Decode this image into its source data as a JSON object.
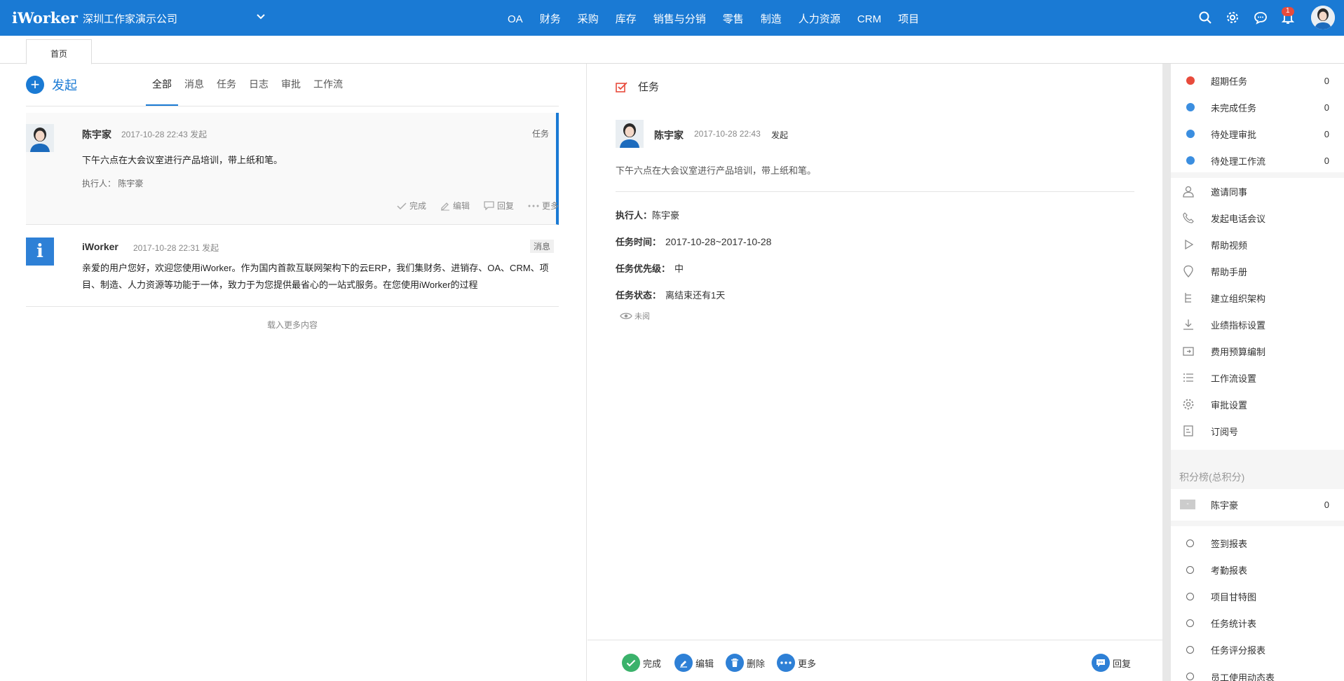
{
  "topbar": {
    "logo": "iWorker",
    "company": "深圳工作家演示公司",
    "nav": [
      "OA",
      "财务",
      "采购",
      "库存",
      "销售与分销",
      "零售",
      "制造",
      "人力资源",
      "CRM",
      "项目"
    ],
    "notification_count": "1",
    "icons": [
      "search-icon",
      "gear-icon",
      "chat-icon",
      "bell-icon",
      "avatar"
    ]
  },
  "tabs": {
    "home": "首页"
  },
  "left": {
    "launch_label": "发起",
    "filters": [
      "全部",
      "消息",
      "任务",
      "日志",
      "审批",
      "工作流"
    ],
    "active_filter": "全部",
    "feed": [
      {
        "author": "陈宇家",
        "time": "2017-10-28 22:43 发起",
        "tag": "任务",
        "content": "下午六点在大会议室进行产品培训，带上纸和笔。",
        "executor": "执行人：  陈宇豪",
        "actions": [
          "完成",
          "编辑",
          "回复",
          "更多"
        ]
      },
      {
        "author": "iWorker",
        "time": "2017-10-28 22:31 发起",
        "tag": "消息",
        "content": "亲爱的用户您好，欢迎您使用iWorker。作为国内首款互联网架构下的云ERP，我们集财务、进销存、OA、CRM、项目、制造、人力资源等功能于一体，致力于为您提供最省心的一站式服务。在您使用iWorker的过程"
      }
    ],
    "load_more": "载入更多内容"
  },
  "detail": {
    "header": "任务",
    "author": "陈宇家",
    "time": "2017-10-28 22:43",
    "action": "发起",
    "content": "下午六点在大会议室进行产品培训，带上纸和笔。",
    "executor_label": "执行人：",
    "executor_value": "陈宇豪",
    "time_label": "任务时间：",
    "time_value": "2017-10-28~2017-10-28",
    "priority_label": "任务优先级：",
    "priority_value": "中",
    "status_label": "任务状态：",
    "status_value": "离结束还有1天",
    "unread": "未阅",
    "buttons": {
      "complete": "完成",
      "edit": "编辑",
      "delete": "删除",
      "more": "更多",
      "reply": "回复"
    }
  },
  "right": {
    "stats": [
      {
        "label": "超期任务",
        "count": "0",
        "color": "#e84b3c"
      },
      {
        "label": "未完成任务",
        "count": "0",
        "color": "#3b8ee0"
      },
      {
        "label": "待处理审批",
        "count": "0",
        "color": "#3b8ee0"
      },
      {
        "label": "待处理工作流",
        "count": "0",
        "color": "#3b8ee0"
      }
    ],
    "quick_links": [
      {
        "label": "邀请同事",
        "icon": "user-add-icon"
      },
      {
        "label": "发起电话会议",
        "icon": "phone-icon"
      },
      {
        "label": "帮助视频",
        "icon": "play-icon"
      },
      {
        "label": "帮助手册",
        "icon": "map-pin-icon"
      },
      {
        "label": "建立组织架构",
        "icon": "org-chart-icon"
      },
      {
        "label": "业绩指标设置",
        "icon": "download-icon"
      },
      {
        "label": "费用预算编制",
        "icon": "budget-icon"
      },
      {
        "label": "工作流设置",
        "icon": "list-icon"
      },
      {
        "label": "审批设置",
        "icon": "gear-icon"
      },
      {
        "label": "订阅号",
        "icon": "document-icon"
      }
    ],
    "ranking_title": "积分榜(总积分)",
    "ranking": [
      {
        "badge": "-",
        "name": "陈宇豪",
        "score": "0"
      }
    ],
    "reports": [
      "签到报表",
      "考勤报表",
      "项目甘特图",
      "任务统计表",
      "任务评分报表",
      "员工使用动态表"
    ]
  }
}
